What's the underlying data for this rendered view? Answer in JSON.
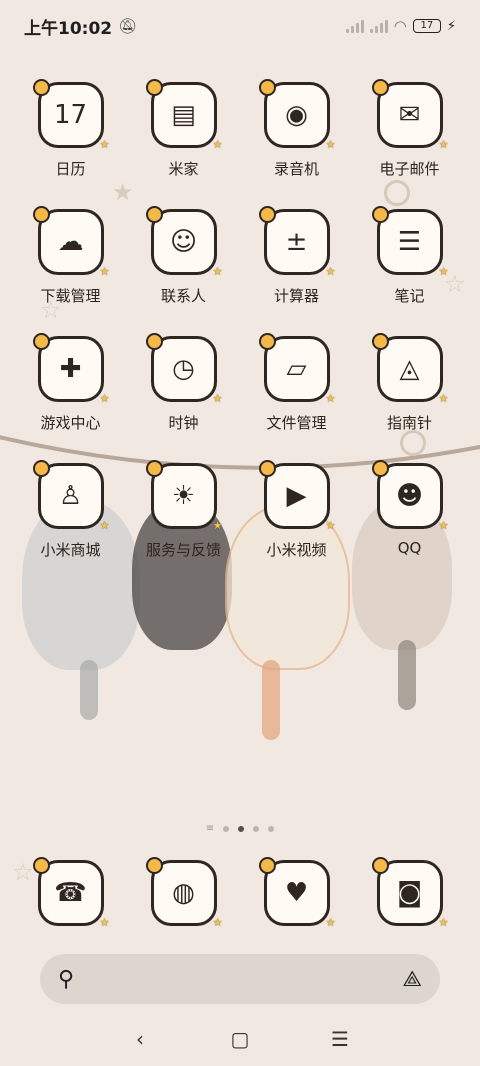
{
  "status_bar": {
    "time": "上午10:02",
    "battery": "17"
  },
  "apps": [
    {
      "label": "日历",
      "icon": "calendar-icon",
      "glyph": "17"
    },
    {
      "label": "米家",
      "icon": "smart-home-icon",
      "glyph": "▤"
    },
    {
      "label": "录音机",
      "icon": "recorder-icon",
      "glyph": "◉"
    },
    {
      "label": "电子邮件",
      "icon": "mail-icon",
      "glyph": "✉"
    },
    {
      "label": "下载管理",
      "icon": "download-icon",
      "glyph": "☁"
    },
    {
      "label": "联系人",
      "icon": "contacts-icon",
      "glyph": "☺"
    },
    {
      "label": "计算器",
      "icon": "calculator-icon",
      "glyph": "±"
    },
    {
      "label": "笔记",
      "icon": "notes-icon",
      "glyph": "☰"
    },
    {
      "label": "游戏中心",
      "icon": "gamepad-icon",
      "glyph": "✚"
    },
    {
      "label": "时钟",
      "icon": "clock-icon",
      "glyph": "◷"
    },
    {
      "label": "文件管理",
      "icon": "files-icon",
      "glyph": "▱"
    },
    {
      "label": "指南针",
      "icon": "compass-icon",
      "glyph": "◬"
    },
    {
      "label": "小米商城",
      "icon": "store-bag-icon",
      "glyph": "♙"
    },
    {
      "label": "服务与反馈",
      "icon": "lightbulb-icon",
      "glyph": "☀"
    },
    {
      "label": "小米视频",
      "icon": "video-icon",
      "glyph": "▶"
    },
    {
      "label": "QQ",
      "icon": "qq-icon",
      "glyph": "☻"
    }
  ],
  "dock": [
    {
      "icon": "phone-icon",
      "glyph": "☎"
    },
    {
      "icon": "browser-globe-icon",
      "glyph": "◍"
    },
    {
      "icon": "messages-icon",
      "glyph": "♥"
    },
    {
      "icon": "camera-icon",
      "glyph": "◙"
    }
  ],
  "pager": {
    "pages": 4,
    "active": 1
  },
  "search": {
    "placeholder": ""
  },
  "colors": {
    "background": "#f1e9e1",
    "icon_border": "#2f2622",
    "icon_fill": "#fffaf3",
    "badge": "#f5b949"
  }
}
